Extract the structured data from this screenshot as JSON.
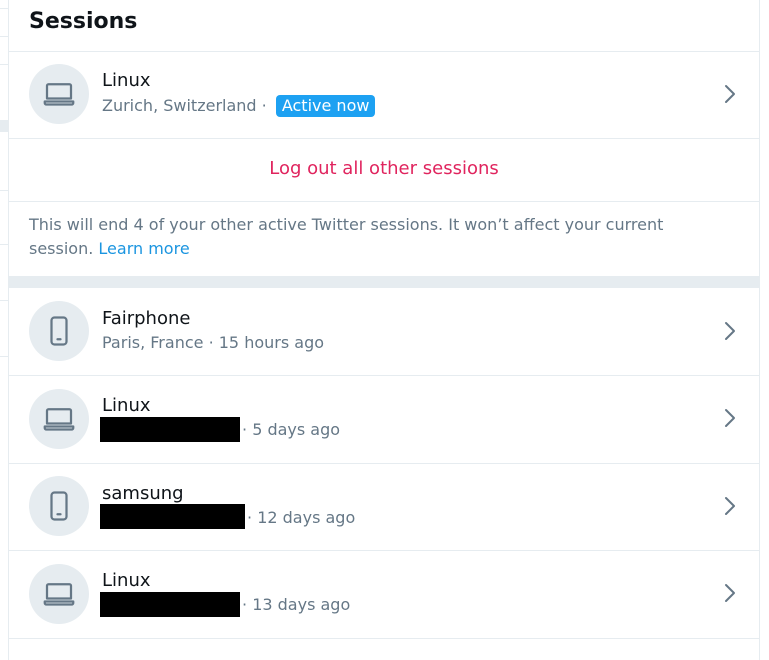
{
  "header": {
    "title": "Sessions"
  },
  "current_session": {
    "device": "Linux",
    "location": "Zurich, Switzerland",
    "separator": "·",
    "badge": "Active now",
    "icon": "laptop-icon"
  },
  "logout": {
    "label": "Log out all other sessions"
  },
  "note": {
    "text": "This will end 4 of your other active Twitter sessions. It won’t affect your current session.",
    "link": "Learn more"
  },
  "sessions": [
    {
      "device": "Fairphone",
      "location": "Paris, France",
      "time": "15 hours ago",
      "icon": "phone-icon"
    },
    {
      "device": "Linux",
      "location": "",
      "time": "5 days ago",
      "icon": "laptop-icon"
    },
    {
      "device": "samsung",
      "location": "",
      "time": "12 days ago",
      "icon": "phone-icon"
    },
    {
      "device": "Linux",
      "location": "",
      "time": "13 days ago",
      "icon": "laptop-icon"
    }
  ],
  "colors": {
    "accent": "#1da1f2",
    "danger": "#e0245e",
    "link": "#1b95e0",
    "muted": "#657786",
    "border": "#e6ecf0"
  }
}
